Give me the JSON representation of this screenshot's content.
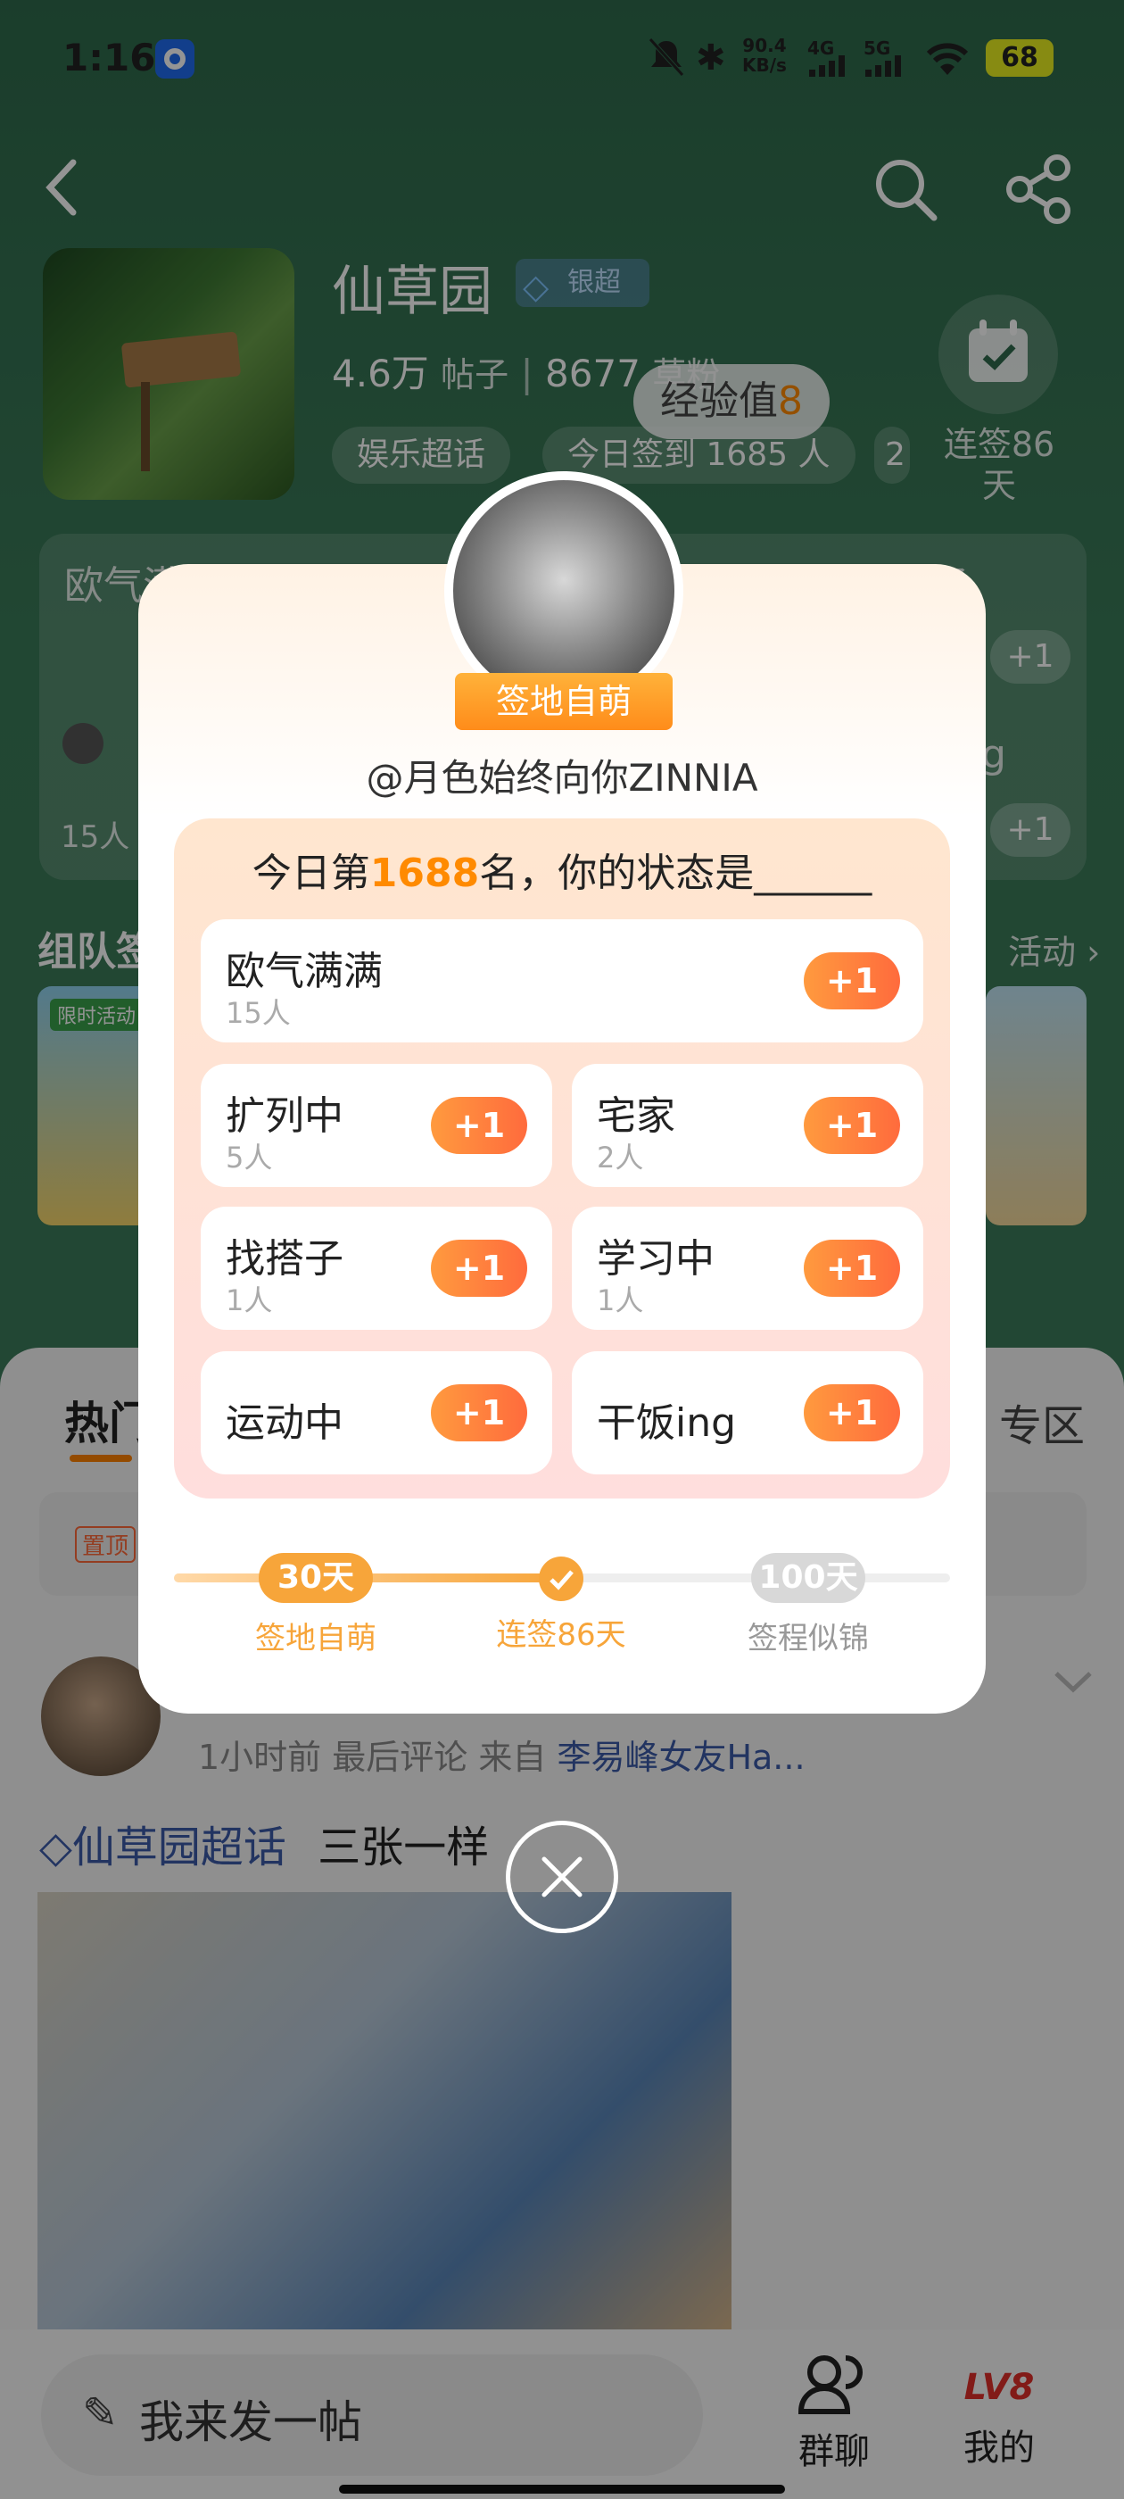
{
  "status_bar": {
    "time": "1:16",
    "net_speed_top": "90.4",
    "net_speed_bottom": "KB/s",
    "signal_4g": "4G",
    "signal_5g": "5G",
    "battery": "68"
  },
  "header": {
    "community_name": "仙草园",
    "badge": "银超",
    "posts_count": "4.6万",
    "posts_label": "帖子",
    "fans_count": "8677",
    "fans_label": "草粉",
    "tags": [
      "娱乐超话",
      "今日签到 1685 人",
      "2"
    ],
    "checkin_streak": "连签86天",
    "exp_label": "经验值",
    "exp_value": "8"
  },
  "bg_sections": {
    "status_card_left": "欧气满满",
    "status_card_mid": "扩列中",
    "status_card_right": "找搭子",
    "status_count_left": "15人",
    "status_plus": "+1",
    "status_right_bottom": "g",
    "team_title": "组队签",
    "activity_link": "活动",
    "limited_badge": "限时活动",
    "hot_tab": "热门",
    "zone_tab": "专区",
    "pin_badge": "置顶"
  },
  "post": {
    "meta": "1小时前 最后评论  来自",
    "source": "李易峰女友Ha...",
    "topic": "仙草园超话",
    "text": "三张一样"
  },
  "bottom_bar": {
    "compose_placeholder": "我来发一帖",
    "group_chat": "群聊",
    "mine": "我的",
    "level": "LV8"
  },
  "popup": {
    "user_title": "签地自萌",
    "username": "@月色始终向你ZINNIA",
    "question_prefix": "今日第",
    "rank": "1688",
    "question_suffix": "名，你的状态是______",
    "plus_label": "+1",
    "options": [
      {
        "title": "欧气满满",
        "count": "15人"
      },
      {
        "title": "扩列中",
        "count": "5人"
      },
      {
        "title": "宅家",
        "count": "2人"
      },
      {
        "title": "找搭子",
        "count": "1人"
      },
      {
        "title": "学习中",
        "count": "1人"
      },
      {
        "title": "运动中",
        "count": ""
      },
      {
        "title": "干饭ing",
        "count": ""
      }
    ],
    "milestones": [
      {
        "day": "30天",
        "label": "签地自萌"
      },
      {
        "day": "",
        "label": "连签86天"
      },
      {
        "day": "100天",
        "label": "签程似锦"
      }
    ],
    "progress_fraction": 0.5
  },
  "colors": {
    "accent_orange": "#ff7a2a",
    "rank_orange": "#ff8a00",
    "link_blue": "#3b5ba8"
  }
}
